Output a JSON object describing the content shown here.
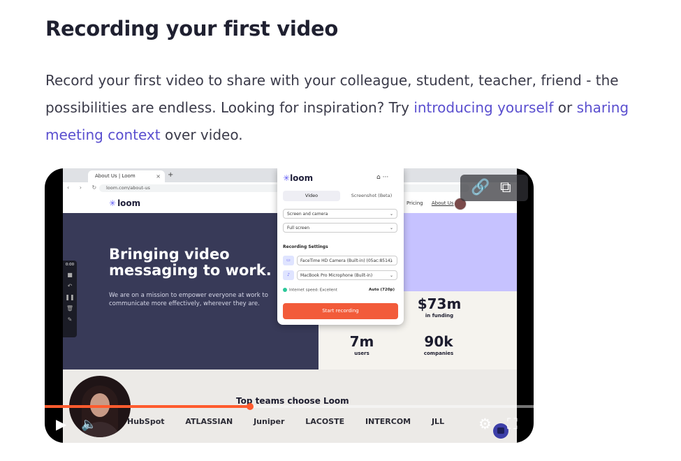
{
  "article": {
    "title": "Recording your first video",
    "para_1": "Record your first video to share with your colleague, student, teacher, friend - the possibilities are endless. Looking for inspiration? Try ",
    "link_1": "introducing yourself",
    "para_2": " or ",
    "link_2": "sharing meeting context",
    "para_3": " over video."
  },
  "video": {
    "browser": {
      "tab_title": "About Us | Loom",
      "tab_close": "×",
      "tab_new": "+",
      "nav_icons": "‹ › ↻",
      "url": "loom.com/about-us"
    },
    "site": {
      "logo_icon": "✳",
      "logo_text": "loom",
      "nav_pricing": "Pricing",
      "nav_about": "About Us",
      "hero_title_1": "Bringing video",
      "hero_title_2": "messaging to work.",
      "hero_sub": "We are on a mission to empower everyone at work to communicate more effectively, wherever they are.",
      "stats": [
        {
          "value": "$73m",
          "label": "in funding"
        },
        {
          "value": "7m",
          "label": "users"
        },
        {
          "value": "90k",
          "label": "companies"
        }
      ],
      "logos_title": "Top teams choose Loom",
      "logos": [
        "HubSpot",
        "ATLASSIAN",
        "Juniper",
        "LACOSTE",
        "INTERCOM",
        "JLL"
      ]
    },
    "recorder_toolbar": {
      "time": "0:00",
      "tool_icons": [
        "■",
        "↶",
        "❚❚",
        "🗑",
        "✎"
      ]
    },
    "popup": {
      "logo_icon": "✳",
      "logo_text": "loom",
      "home_icon": "⌂",
      "more_icon": "···",
      "tab_video": "Video",
      "tab_screenshot": "Screenshot (Beta)",
      "capture_mode": "Screen and camera",
      "capture_area": "Full screen",
      "section_label": "Recording Settings",
      "camera": "FaceTime HD Camera (Built-in) (05ac:8514)",
      "microphone": "MacBook Pro Microphone (Built-in)",
      "speed_label": "Internet speed: Excellent",
      "quality": "Auto (720p)",
      "start_label": "Start recording",
      "chevron": "⌄"
    },
    "share": {
      "link_icon": "🔗",
      "external_icon": "⧉"
    },
    "player": {
      "progress_fraction": 0.42,
      "play_icon": "▶",
      "volume_icon": "🔈",
      "settings_icon": "⚙",
      "fullscreen_icon": "⛶"
    }
  }
}
